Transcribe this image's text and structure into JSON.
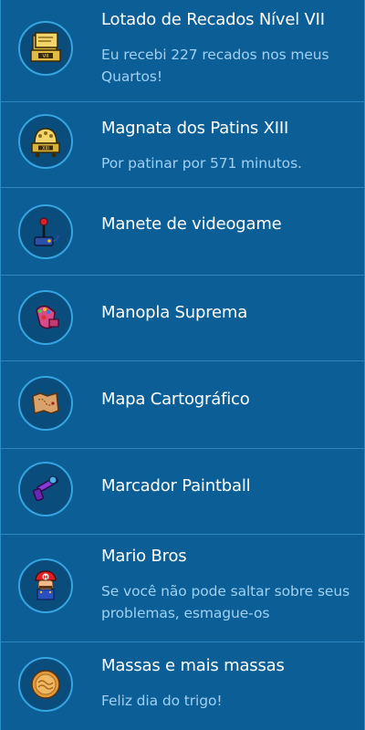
{
  "colors": {
    "background": "#0b5f96",
    "badge_ring": "#36a4e0",
    "title_text": "#ffffff",
    "description_text": "#9fd0f3",
    "divider": "#2c86c2"
  },
  "badges": [
    {
      "title": "Lotado de Recados Nível VII",
      "description": "Eu recebi 227 recados nos meus Quartos!",
      "icon": "gold-notes-badge-icon"
    },
    {
      "title": "Magnata dos Patins XIII",
      "description": "Por patinar por 571 minutos.",
      "icon": "gold-skate-badge-icon"
    },
    {
      "title": "Manete de videogame",
      "description": "",
      "icon": "joystick-icon"
    },
    {
      "title": "Manopla Suprema",
      "description": "",
      "icon": "gauntlet-icon"
    },
    {
      "title": "Mapa Cartográfico",
      "description": "",
      "icon": "map-scroll-icon"
    },
    {
      "title": "Marcador Paintball",
      "description": "",
      "icon": "paintball-marker-icon"
    },
    {
      "title": "Mario Bros",
      "description": "Se você não pode saltar sobre seus problemas, esmague-os",
      "icon": "mario-icon"
    },
    {
      "title": "Massas e mais massas",
      "description": "Feliz dia do trigo!",
      "icon": "pasta-coin-icon"
    }
  ]
}
